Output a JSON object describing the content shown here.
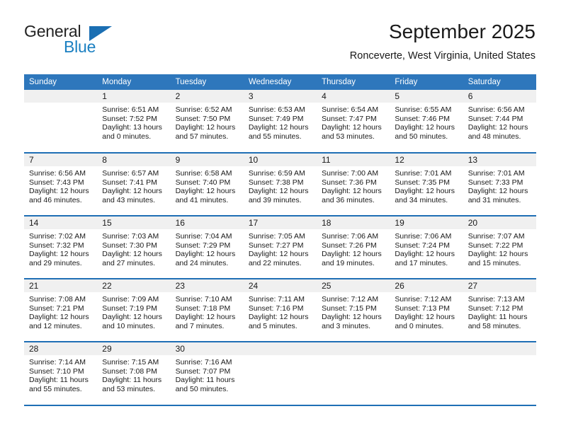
{
  "brand": {
    "name_part1": "General",
    "name_part2": "Blue",
    "triangle_color": "#1b6fb3",
    "blue_text_color": "#1a7fc1"
  },
  "header": {
    "title": "September 2025",
    "location": "Ronceverte, West Virginia, United States",
    "accent_color": "#2e77bc",
    "separator_color": "#1f6fb5",
    "daynumber_band_color": "#f0f0f0"
  },
  "weekdays": [
    "Sunday",
    "Monday",
    "Tuesday",
    "Wednesday",
    "Thursday",
    "Friday",
    "Saturday"
  ],
  "weeks": [
    [
      {
        "day": "",
        "empty": true
      },
      {
        "day": "1",
        "sunrise": "Sunrise: 6:51 AM",
        "sunset": "Sunset: 7:52 PM",
        "daylight1": "Daylight: 13 hours",
        "daylight2": "and 0 minutes."
      },
      {
        "day": "2",
        "sunrise": "Sunrise: 6:52 AM",
        "sunset": "Sunset: 7:50 PM",
        "daylight1": "Daylight: 12 hours",
        "daylight2": "and 57 minutes."
      },
      {
        "day": "3",
        "sunrise": "Sunrise: 6:53 AM",
        "sunset": "Sunset: 7:49 PM",
        "daylight1": "Daylight: 12 hours",
        "daylight2": "and 55 minutes."
      },
      {
        "day": "4",
        "sunrise": "Sunrise: 6:54 AM",
        "sunset": "Sunset: 7:47 PM",
        "daylight1": "Daylight: 12 hours",
        "daylight2": "and 53 minutes."
      },
      {
        "day": "5",
        "sunrise": "Sunrise: 6:55 AM",
        "sunset": "Sunset: 7:46 PM",
        "daylight1": "Daylight: 12 hours",
        "daylight2": "and 50 minutes."
      },
      {
        "day": "6",
        "sunrise": "Sunrise: 6:56 AM",
        "sunset": "Sunset: 7:44 PM",
        "daylight1": "Daylight: 12 hours",
        "daylight2": "and 48 minutes."
      }
    ],
    [
      {
        "day": "7",
        "sunrise": "Sunrise: 6:56 AM",
        "sunset": "Sunset: 7:43 PM",
        "daylight1": "Daylight: 12 hours",
        "daylight2": "and 46 minutes."
      },
      {
        "day": "8",
        "sunrise": "Sunrise: 6:57 AM",
        "sunset": "Sunset: 7:41 PM",
        "daylight1": "Daylight: 12 hours",
        "daylight2": "and 43 minutes."
      },
      {
        "day": "9",
        "sunrise": "Sunrise: 6:58 AM",
        "sunset": "Sunset: 7:40 PM",
        "daylight1": "Daylight: 12 hours",
        "daylight2": "and 41 minutes."
      },
      {
        "day": "10",
        "sunrise": "Sunrise: 6:59 AM",
        "sunset": "Sunset: 7:38 PM",
        "daylight1": "Daylight: 12 hours",
        "daylight2": "and 39 minutes."
      },
      {
        "day": "11",
        "sunrise": "Sunrise: 7:00 AM",
        "sunset": "Sunset: 7:36 PM",
        "daylight1": "Daylight: 12 hours",
        "daylight2": "and 36 minutes."
      },
      {
        "day": "12",
        "sunrise": "Sunrise: 7:01 AM",
        "sunset": "Sunset: 7:35 PM",
        "daylight1": "Daylight: 12 hours",
        "daylight2": "and 34 minutes."
      },
      {
        "day": "13",
        "sunrise": "Sunrise: 7:01 AM",
        "sunset": "Sunset: 7:33 PM",
        "daylight1": "Daylight: 12 hours",
        "daylight2": "and 31 minutes."
      }
    ],
    [
      {
        "day": "14",
        "sunrise": "Sunrise: 7:02 AM",
        "sunset": "Sunset: 7:32 PM",
        "daylight1": "Daylight: 12 hours",
        "daylight2": "and 29 minutes."
      },
      {
        "day": "15",
        "sunrise": "Sunrise: 7:03 AM",
        "sunset": "Sunset: 7:30 PM",
        "daylight1": "Daylight: 12 hours",
        "daylight2": "and 27 minutes."
      },
      {
        "day": "16",
        "sunrise": "Sunrise: 7:04 AM",
        "sunset": "Sunset: 7:29 PM",
        "daylight1": "Daylight: 12 hours",
        "daylight2": "and 24 minutes."
      },
      {
        "day": "17",
        "sunrise": "Sunrise: 7:05 AM",
        "sunset": "Sunset: 7:27 PM",
        "daylight1": "Daylight: 12 hours",
        "daylight2": "and 22 minutes."
      },
      {
        "day": "18",
        "sunrise": "Sunrise: 7:06 AM",
        "sunset": "Sunset: 7:26 PM",
        "daylight1": "Daylight: 12 hours",
        "daylight2": "and 19 minutes."
      },
      {
        "day": "19",
        "sunrise": "Sunrise: 7:06 AM",
        "sunset": "Sunset: 7:24 PM",
        "daylight1": "Daylight: 12 hours",
        "daylight2": "and 17 minutes."
      },
      {
        "day": "20",
        "sunrise": "Sunrise: 7:07 AM",
        "sunset": "Sunset: 7:22 PM",
        "daylight1": "Daylight: 12 hours",
        "daylight2": "and 15 minutes."
      }
    ],
    [
      {
        "day": "21",
        "sunrise": "Sunrise: 7:08 AM",
        "sunset": "Sunset: 7:21 PM",
        "daylight1": "Daylight: 12 hours",
        "daylight2": "and 12 minutes."
      },
      {
        "day": "22",
        "sunrise": "Sunrise: 7:09 AM",
        "sunset": "Sunset: 7:19 PM",
        "daylight1": "Daylight: 12 hours",
        "daylight2": "and 10 minutes."
      },
      {
        "day": "23",
        "sunrise": "Sunrise: 7:10 AM",
        "sunset": "Sunset: 7:18 PM",
        "daylight1": "Daylight: 12 hours",
        "daylight2": "and 7 minutes."
      },
      {
        "day": "24",
        "sunrise": "Sunrise: 7:11 AM",
        "sunset": "Sunset: 7:16 PM",
        "daylight1": "Daylight: 12 hours",
        "daylight2": "and 5 minutes."
      },
      {
        "day": "25",
        "sunrise": "Sunrise: 7:12 AM",
        "sunset": "Sunset: 7:15 PM",
        "daylight1": "Daylight: 12 hours",
        "daylight2": "and 3 minutes."
      },
      {
        "day": "26",
        "sunrise": "Sunrise: 7:12 AM",
        "sunset": "Sunset: 7:13 PM",
        "daylight1": "Daylight: 12 hours",
        "daylight2": "and 0 minutes."
      },
      {
        "day": "27",
        "sunrise": "Sunrise: 7:13 AM",
        "sunset": "Sunset: 7:12 PM",
        "daylight1": "Daylight: 11 hours",
        "daylight2": "and 58 minutes."
      }
    ],
    [
      {
        "day": "28",
        "sunrise": "Sunrise: 7:14 AM",
        "sunset": "Sunset: 7:10 PM",
        "daylight1": "Daylight: 11 hours",
        "daylight2": "and 55 minutes."
      },
      {
        "day": "29",
        "sunrise": "Sunrise: 7:15 AM",
        "sunset": "Sunset: 7:08 PM",
        "daylight1": "Daylight: 11 hours",
        "daylight2": "and 53 minutes."
      },
      {
        "day": "30",
        "sunrise": "Sunrise: 7:16 AM",
        "sunset": "Sunset: 7:07 PM",
        "daylight1": "Daylight: 11 hours",
        "daylight2": "and 50 minutes."
      },
      {
        "day": "",
        "empty": true
      },
      {
        "day": "",
        "empty": true
      },
      {
        "day": "",
        "empty": true
      },
      {
        "day": "",
        "empty": true
      }
    ]
  ]
}
